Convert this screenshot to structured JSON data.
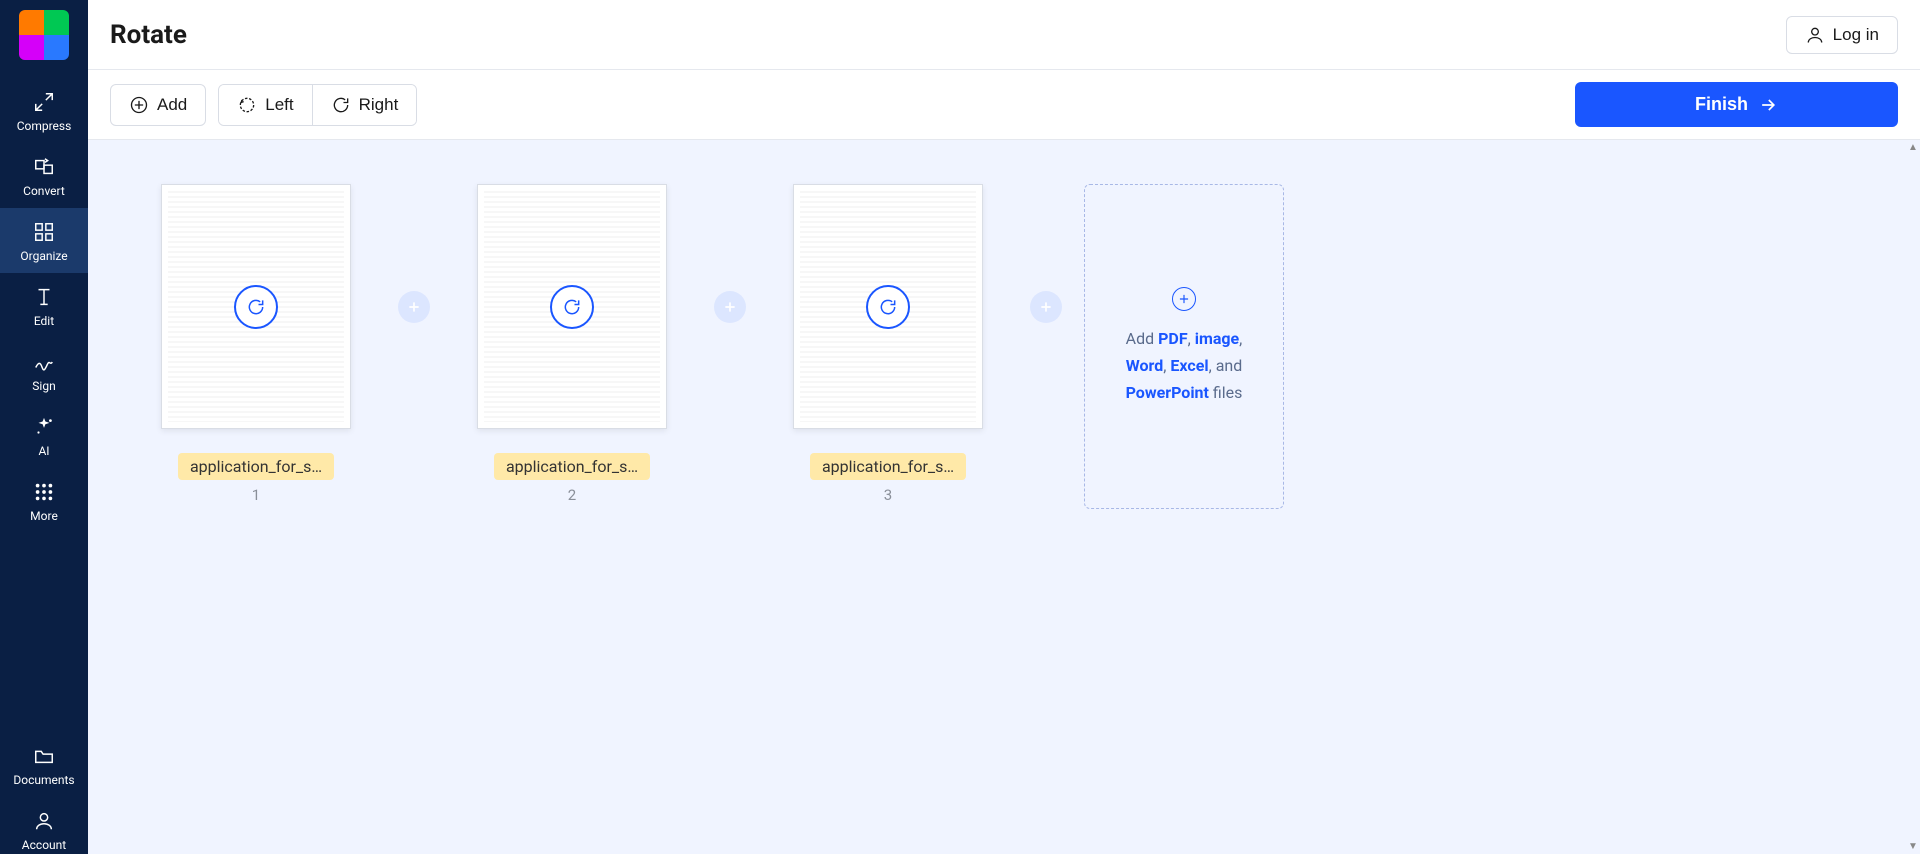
{
  "header": {
    "title": "Rotate",
    "login": "Log in"
  },
  "toolbar": {
    "add": "Add",
    "left": "Left",
    "right": "Right",
    "finish": "Finish"
  },
  "sidebar": {
    "items": [
      {
        "label": "Compress"
      },
      {
        "label": "Convert"
      },
      {
        "label": "Organize"
      },
      {
        "label": "Edit"
      },
      {
        "label": "Sign"
      },
      {
        "label": "AI"
      },
      {
        "label": "More"
      },
      {
        "label": "Documents"
      },
      {
        "label": "Account"
      }
    ]
  },
  "pages": [
    {
      "filename": "application_for_s…",
      "num": "1"
    },
    {
      "filename": "application_for_s…",
      "num": "2"
    },
    {
      "filename": "application_for_s…",
      "num": "3"
    }
  ],
  "addCard": {
    "prefix": "Add ",
    "pdf": "PDF",
    "comma": ", ",
    "image": "image",
    "word": "Word",
    "excel": "Excel",
    "and": ", and ",
    "ppt": "PowerPoint",
    "suffix": " files"
  }
}
